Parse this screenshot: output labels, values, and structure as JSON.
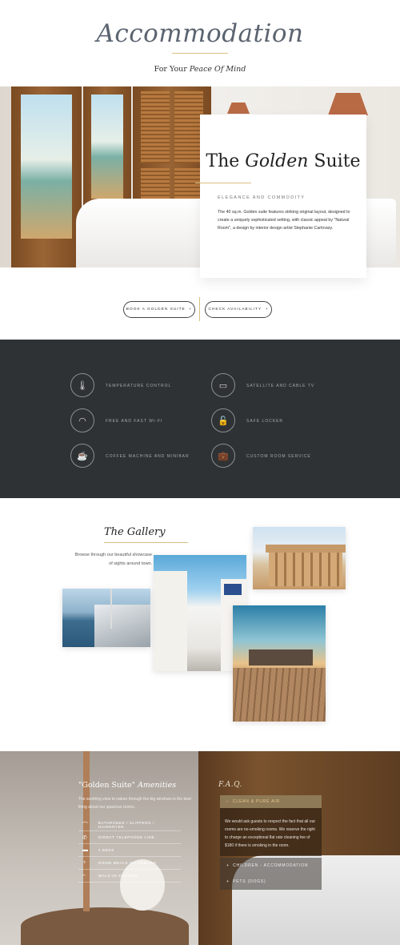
{
  "header": {
    "title": "Accommodation",
    "subtitle_plain": "For Your ",
    "subtitle_italic": "Peace Of Mind"
  },
  "hero_card": {
    "title_a": "The ",
    "title_b": "Golden",
    "title_c": " Suite",
    "kicker": "ELEGANCE AND COMMODITY",
    "body": "The 40 sq.m. Golden suite features striking original layout, designed to create a uniquely sophisticated setting, with classic appeal by \"Natural Room\", a design by interior design artist Stephanie Carlovary."
  },
  "cta": {
    "book": "BOOK A GOLDEN SUITE",
    "check": "CHECK AVAILABILITY",
    "arrow": "+"
  },
  "features": [
    {
      "icon": "thermometer-icon",
      "glyph": "🌡",
      "label": "TEMPERATURE CONTROL"
    },
    {
      "icon": "tv-icon",
      "glyph": "▭",
      "label": "SATELLITE AND CABLE TV"
    },
    {
      "icon": "wifi-icon",
      "glyph": "◠",
      "label": "FREE AND FAST WI-FI"
    },
    {
      "icon": "lock-icon",
      "glyph": "🔓",
      "label": "SAFE LOCKER"
    },
    {
      "icon": "coffee-icon",
      "glyph": "☕",
      "label": "COFFEE MACHINE AND MINIBAR"
    },
    {
      "icon": "suitcase-icon",
      "glyph": "💼",
      "label": "CUSTOM ROOM SERVICE"
    }
  ],
  "gallery": {
    "title": "The Gallery",
    "text": "Browse through our beautiful showcase of sights around town."
  },
  "amenities": {
    "title_a": "\"Golden Suite\" ",
    "title_b": "Amenities",
    "text": "The soothing view to nature through the big windows is the best thing about our spacious rooms.",
    "items": [
      {
        "icon": "hanger-icon",
        "glyph": "⌒",
        "label": "BATHROBES / SLIPPERS / HAIRDRYER"
      },
      {
        "icon": "phone-icon",
        "glyph": "✆",
        "label": "DIRECT TELEPHONE LINE"
      },
      {
        "icon": "bed-icon",
        "glyph": "▬",
        "label": "4 BEDS"
      },
      {
        "icon": "cutlery-icon",
        "glyph": "♆",
        "label": "ROOM MEALS ON DEMAND"
      },
      {
        "icon": "shower-icon",
        "glyph": "⌐",
        "label": "WALK-IN SHOWER"
      }
    ]
  },
  "faq": {
    "title": "F.A.Q.",
    "open_q": "CLEAN & PURE AIR",
    "open_a": "We would ask guests to respect the fact that all our rooms are no-smoking rooms. We reserve the right to charge an exceptional flat rate cleaning fee of $180 if there is smoking in the room.",
    "items": [
      "CHILDREN - ACCOMMODATION",
      "PETS (DOGS)"
    ],
    "open_sign": "–",
    "closed_sign": "+"
  }
}
